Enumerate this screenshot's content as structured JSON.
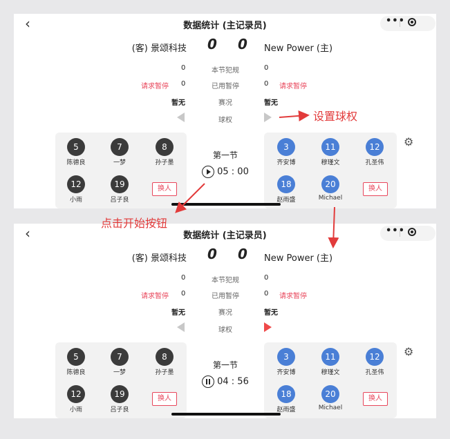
{
  "colors": {
    "accent_red": "#e8455a",
    "annotation_red": "#e23b3b",
    "home_blue": "#4a7fd6",
    "away_dark": "#3b3b3b"
  },
  "nav": {
    "title": "数据统计 (主记录员)",
    "back_icon": "chevron-left-icon",
    "more_label": "•••"
  },
  "match": {
    "away_team": "(客) 景颂科技",
    "home_team": "New Power (主)",
    "away_score": "0",
    "home_score": "0",
    "labels": {
      "fouls": "本节犯规",
      "timeouts_used": "已用暂停",
      "status": "赛况",
      "possession": "球权"
    },
    "away_fouls": "0",
    "home_fouls": "0",
    "away_timeouts": "0",
    "home_timeouts": "0",
    "request_timeout": "请求暂停",
    "away_status": "暂无",
    "home_status": "暂无",
    "period": "第一节",
    "substitute": "换人"
  },
  "away_players": [
    {
      "number": "5",
      "name": "陈德良"
    },
    {
      "number": "7",
      "name": "一梦"
    },
    {
      "number": "8",
      "name": "孙子墨"
    },
    {
      "number": "12",
      "name": "小雨"
    },
    {
      "number": "19",
      "name": "吕子良"
    }
  ],
  "home_players": [
    {
      "number": "3",
      "name": "齐安博"
    },
    {
      "number": "11",
      "name": "穆瑾文"
    },
    {
      "number": "12",
      "name": "孔圣伟"
    },
    {
      "number": "18",
      "name": "赵雨盛"
    },
    {
      "number": "20",
      "name": "Michael"
    }
  ],
  "states": {
    "before": {
      "timer": "05 : 00",
      "control_icon": "play-icon",
      "possession_home_active": false
    },
    "after": {
      "timer": "04 : 56",
      "control_icon": "pause-icon",
      "possession_home_active": true
    }
  },
  "annotations": {
    "set_possession": "设置球权",
    "click_start": "点击开始按钮"
  }
}
